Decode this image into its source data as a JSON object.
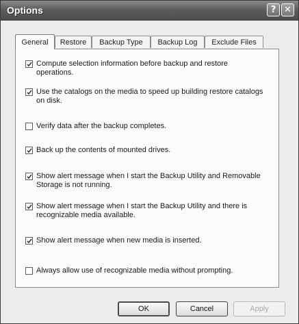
{
  "window": {
    "title": "Options"
  },
  "titlebar": {
    "help_glyph": "?",
    "close_glyph": "✕"
  },
  "tabs": [
    {
      "label": "General",
      "active": true
    },
    {
      "label": "Restore",
      "active": false
    },
    {
      "label": "Backup Type",
      "active": false
    },
    {
      "label": "Backup Log",
      "active": false
    },
    {
      "label": "Exclude Files",
      "active": false
    }
  ],
  "options": [
    {
      "label": "Compute selection information before backup and restore operations.",
      "checked": true
    },
    {
      "label": "Use the catalogs on the media to speed up building restore catalogs on disk.",
      "checked": true
    },
    {
      "label": "Verify data after the backup completes.",
      "checked": false
    },
    {
      "label": "Back up the contents of mounted drives.",
      "checked": true
    },
    {
      "label": "Show alert message when I start the Backup Utility and Removable Storage is not running.",
      "checked": true
    },
    {
      "label": "Show alert message when I start the Backup Utility and there is recognizable media available.",
      "checked": true
    },
    {
      "label": "Show alert message when new media is inserted.",
      "checked": true
    },
    {
      "label": "Always allow use of recognizable media without prompting.",
      "checked": false
    }
  ],
  "buttons": {
    "ok_label": "OK",
    "cancel_label": "Cancel",
    "apply_label": "Apply"
  }
}
